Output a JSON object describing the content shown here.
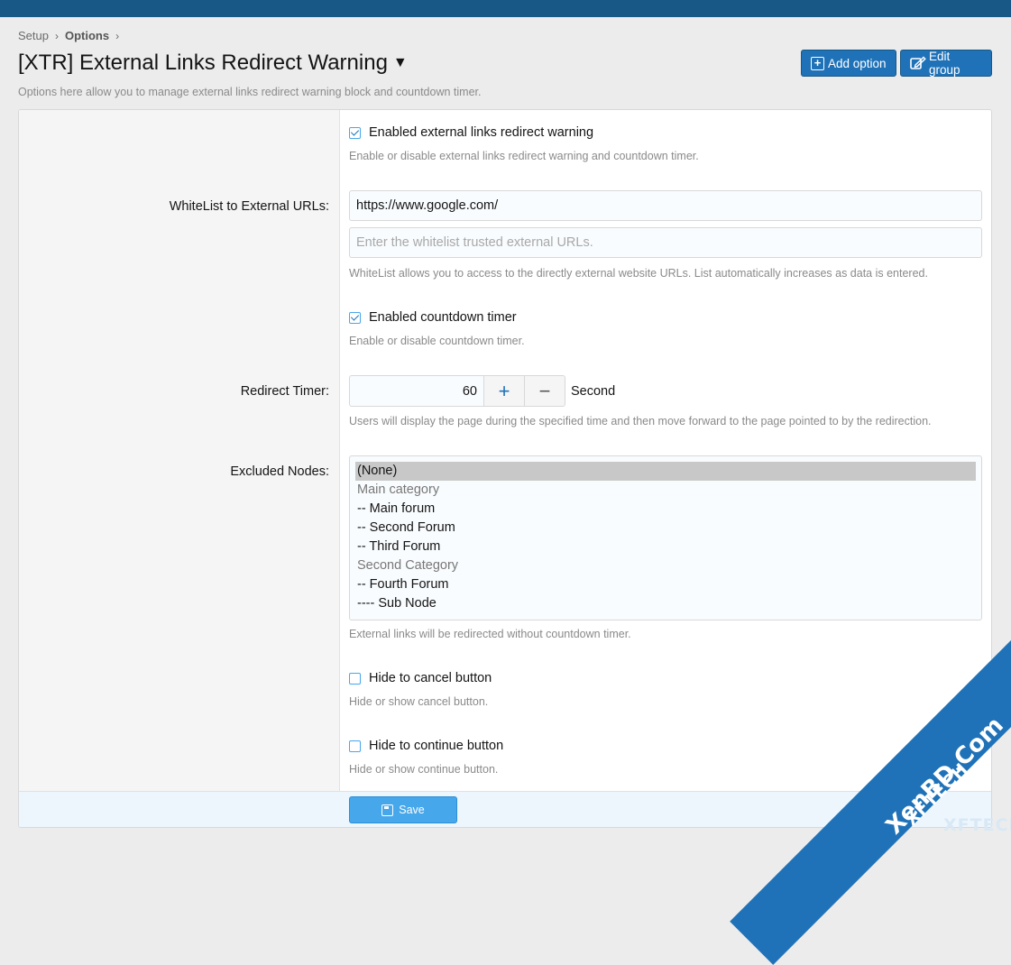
{
  "breadcrumb": {
    "items": [
      "Setup",
      "Options"
    ],
    "separator": "›"
  },
  "page": {
    "title": "[XTR] External Links Redirect Warning",
    "caret": "▼",
    "description": "Options here allow you to manage external links redirect warning block and countdown timer."
  },
  "header_buttons": {
    "add_option": "Add option",
    "edit_group": "Edit group"
  },
  "form": {
    "enable_warning": {
      "label": "Enabled external links redirect warning",
      "checked": true,
      "hint": "Enable or disable external links redirect warning and countdown timer."
    },
    "whitelist": {
      "label": "WhiteList to External URLs:",
      "value": "https://www.google.com/",
      "placeholder": "Enter the whitelist trusted external URLs.",
      "hint": "WhiteList allows you to access to the directly external website URLs. List automatically increases as data is entered."
    },
    "enable_countdown": {
      "label": "Enabled countdown timer",
      "checked": true,
      "hint": "Enable or disable countdown timer."
    },
    "redirect_timer": {
      "label": "Redirect Timer:",
      "value": "60",
      "plus": "+",
      "minus": "−",
      "unit": "Second",
      "hint": "Users will display the page during the specified time and then move forward to the page pointed to by the redirection."
    },
    "excluded_nodes": {
      "label": "Excluded Nodes:",
      "options": [
        {
          "text": "(None)",
          "selected": true,
          "group": false
        },
        {
          "text": "Main category",
          "selected": false,
          "group": true
        },
        {
          "text": "-- Main forum",
          "selected": false,
          "group": false
        },
        {
          "text": "-- Second Forum",
          "selected": false,
          "group": false
        },
        {
          "text": "-- Third Forum",
          "selected": false,
          "group": false
        },
        {
          "text": "Second Category",
          "selected": false,
          "group": true
        },
        {
          "text": "-- Fourth Forum",
          "selected": false,
          "group": false
        },
        {
          "text": "---- Sub Node",
          "selected": false,
          "group": false
        }
      ],
      "hint": "External links will be redirected without countdown timer."
    },
    "hide_cancel": {
      "label": "Hide to cancel button",
      "checked": false,
      "hint": "Hide or show cancel button."
    },
    "hide_continue": {
      "label": "Hide to continue button",
      "checked": false,
      "hint": "Hide or show continue button."
    },
    "save_label": "Save"
  },
  "watermark": {
    "line1": "XenBD.Com",
    "line2": "XFTECH",
    "line3": "XFTECH"
  },
  "colors": {
    "topbar": "#185886",
    "primary_button": "#1f72b8",
    "save_button": "#47a7eb"
  }
}
